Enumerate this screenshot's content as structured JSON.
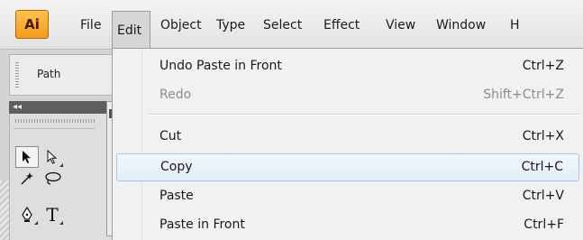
{
  "app": {
    "logo_text": "Ai"
  },
  "menubar": {
    "items": [
      {
        "label": "File"
      },
      {
        "label": "Edit"
      },
      {
        "label": "Object"
      },
      {
        "label": "Type"
      },
      {
        "label": "Select"
      },
      {
        "label": "Effect"
      },
      {
        "label": "View"
      },
      {
        "label": "Window"
      },
      {
        "label": "H"
      }
    ]
  },
  "panels": {
    "path_label": "Path",
    "tools_header_icon": "collapse-chevron-icon"
  },
  "tools": [
    {
      "icon": "selection-arrow-icon",
      "glyph": "➚"
    },
    {
      "icon": "direct-selection-arrow-icon",
      "glyph": "➚"
    },
    {
      "icon": "magic-wand-icon",
      "glyph": "✳"
    },
    {
      "icon": "lasso-icon",
      "glyph": "⪋"
    },
    {
      "icon": "pen-icon",
      "glyph": "♢"
    },
    {
      "icon": "type-icon",
      "glyph": "T"
    }
  ],
  "edit_menu": {
    "items": [
      {
        "label": "Undo Paste in Front",
        "shortcut": "Ctrl+Z",
        "enabled": true
      },
      {
        "label": "Redo",
        "shortcut": "Shift+Ctrl+Z",
        "enabled": false
      },
      {
        "label": "Cut",
        "shortcut": "Ctrl+X",
        "enabled": true
      },
      {
        "label": "Copy",
        "shortcut": "Ctrl+C",
        "enabled": true,
        "highlighted": true
      },
      {
        "label": "Paste",
        "shortcut": "Ctrl+V",
        "enabled": true
      },
      {
        "label": "Paste in Front",
        "shortcut": "Ctrl+F",
        "enabled": true
      }
    ]
  },
  "colors": {
    "logo_bg": "#f7a520",
    "highlight_border": "#a9c6e6",
    "disabled_text": "#8d8d8d"
  }
}
